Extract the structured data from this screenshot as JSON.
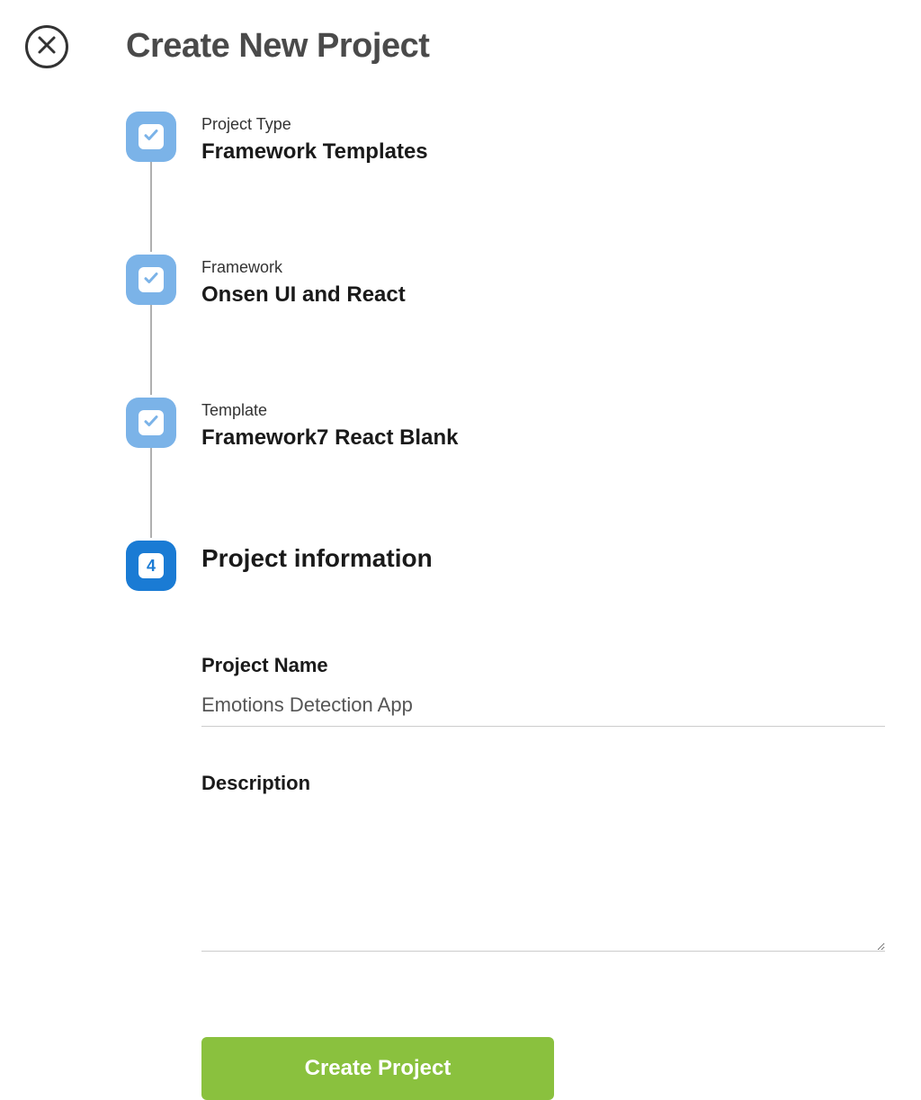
{
  "title": "Create New Project",
  "steps": [
    {
      "label": "Project Type",
      "value": "Framework Templates"
    },
    {
      "label": "Framework",
      "value": "Onsen UI and React"
    },
    {
      "label": "Template",
      "value": "Framework7 React Blank"
    }
  ],
  "current_step": {
    "number": "4",
    "title": "Project information"
  },
  "form": {
    "project_name_label": "Project Name",
    "project_name_value": "Emotions Detection App",
    "description_label": "Description",
    "description_value": ""
  },
  "actions": {
    "create_label": "Create Project"
  },
  "colors": {
    "completed_badge": "#7bb3e8",
    "active_badge": "#1a7bd4",
    "primary_button": "#8ac13e"
  }
}
